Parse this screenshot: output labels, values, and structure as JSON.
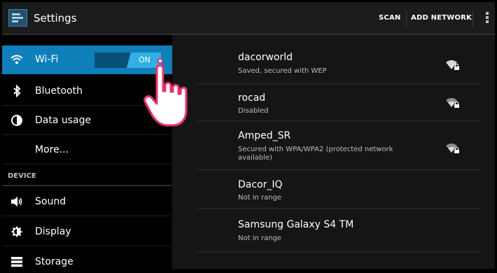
{
  "actionbar": {
    "title": "Settings",
    "scan_label": "SCAN",
    "add_network_label": "ADD NETWORK"
  },
  "sidebar": {
    "items": [
      {
        "label": "Wi-Fi",
        "icon": "wifi-icon",
        "selected": true,
        "toggle": "ON"
      },
      {
        "label": "Bluetooth",
        "icon": "bluetooth-icon"
      },
      {
        "label": "Data usage",
        "icon": "data-usage-icon"
      },
      {
        "label": "More...",
        "icon": ""
      }
    ],
    "section_header": "DEVICE",
    "device_items": [
      {
        "label": "Sound",
        "icon": "sound-icon"
      },
      {
        "label": "Display",
        "icon": "display-icon"
      },
      {
        "label": "Storage",
        "icon": "storage-icon"
      }
    ]
  },
  "networks": [
    {
      "name": "dacorworld",
      "status": "Saved, secured with WEP",
      "secured": true
    },
    {
      "name": "rocad",
      "status": "Disabled",
      "secured": true
    },
    {
      "name": "Amped_SR",
      "status_line1": "Secured with WPA/WPA2 (protected network",
      "status_line2": "available)",
      "secured": true
    },
    {
      "name": "Dacor_IQ",
      "status": "Not in range",
      "secured": false
    },
    {
      "name": "Samsung Galaxy S4 TM",
      "status": "Not in range",
      "secured": false
    }
  ],
  "colors": {
    "accent": "#0e7fb9",
    "toggle_on": "#34aee4",
    "hand_outline": "#e8316e"
  }
}
